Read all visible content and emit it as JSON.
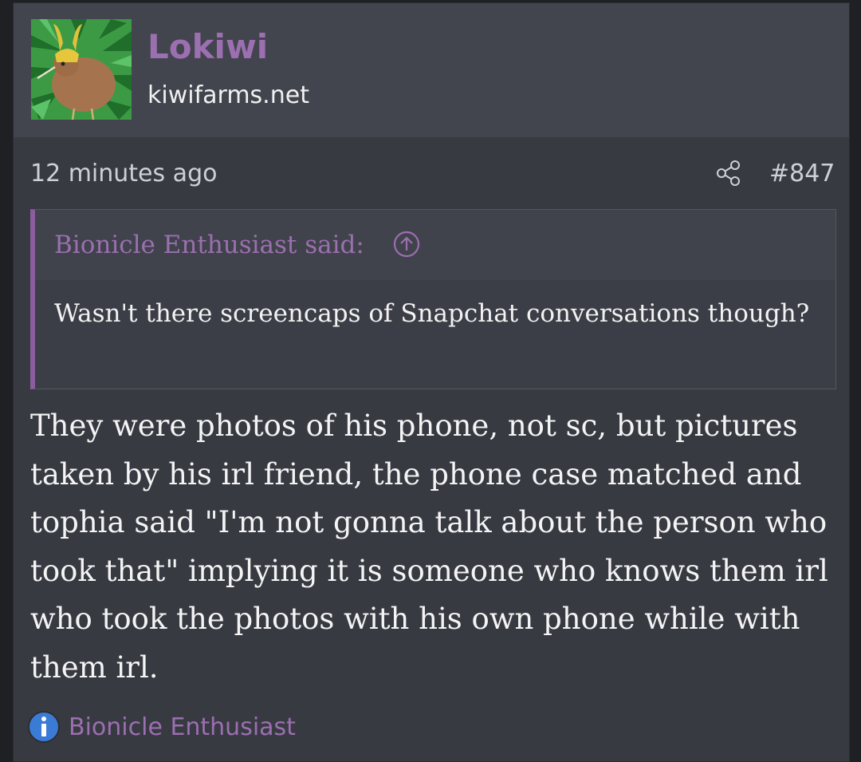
{
  "user": {
    "name": "Lokiwi",
    "site": "kiwifarms.net",
    "avatar_icon": "kiwi-bird-avatar-icon"
  },
  "post": {
    "time": "12 minutes ago",
    "number": "#847",
    "share_icon": "share-icon",
    "quote": {
      "author": "Bionicle Enthusiast said:",
      "arrow_icon": "arrow-up-circle-icon",
      "text": "Wasn't there screencaps of Snapchat conversations though?"
    },
    "body": "They were photos of his phone, not sc, but pictures taken by his irl friend, the phone case matched and tophia said \"I'm not gonna talk about the person who took that\" implying it is someone who knows them irl who took the photos with his own phone while with them irl.",
    "reaction": {
      "icon": "info-icon",
      "user": "Bionicle Enthusiast"
    }
  },
  "colors": {
    "accent": "#9b6fb0",
    "background": "#383a42",
    "header": "#43454e",
    "quote_border": "#8b5d9f",
    "info_blue": "#3a7bd5"
  }
}
